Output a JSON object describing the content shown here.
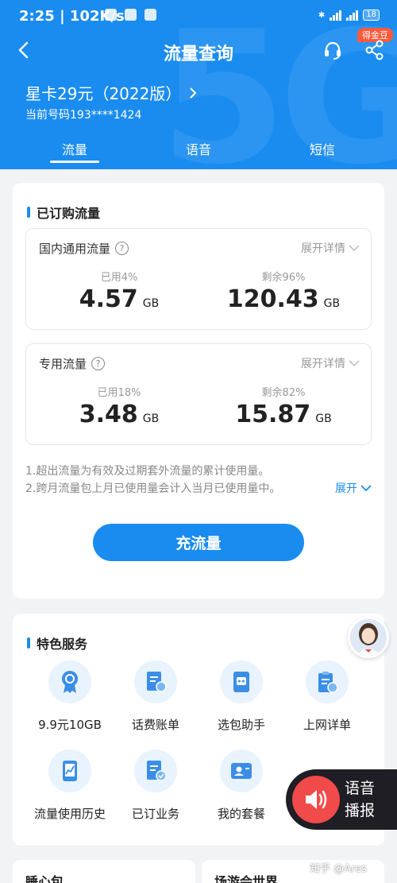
{
  "status_bar": {
    "time": "2:25",
    "speed": "102K/s",
    "battery": "18"
  },
  "header": {
    "title": "流量查询",
    "coupon_badge": "得金豆",
    "plan_name": "星卡29元（2022版）",
    "current_number": "当前号码193****1424"
  },
  "tabs": [
    {
      "label": "流量",
      "active": true
    },
    {
      "label": "语音",
      "active": false
    },
    {
      "label": "短信",
      "active": false
    }
  ],
  "subscribed": {
    "title": "已订购流量",
    "boxes": [
      {
        "title": "国内通用流量",
        "expand": "展开详情",
        "used_label": "已用4%",
        "used_value": "4.57",
        "used_unit": "GB",
        "remain_label": "剩余96%",
        "remain_value": "120.43",
        "remain_unit": "GB"
      },
      {
        "title": "专用流量",
        "expand": "展开详情",
        "used_label": "已用18%",
        "used_value": "3.48",
        "used_unit": "GB",
        "remain_label": "剩余82%",
        "remain_value": "15.87",
        "remain_unit": "GB"
      }
    ],
    "notes": [
      "1.超出流量为有效及过期套外流量的累计使用量。",
      "2.跨月流量包上月已使用量会计入当月已使用量中。"
    ],
    "expand_link": "展开",
    "recharge_button": "充流量"
  },
  "services": {
    "title": "特色服务",
    "items": [
      {
        "label": "9.9元10GB",
        "icon": "badge-icon"
      },
      {
        "label": "话费账单",
        "icon": "bill-icon"
      },
      {
        "label": "选包助手",
        "icon": "robot-icon"
      },
      {
        "label": "上网详单",
        "icon": "clipboard-icon"
      },
      {
        "label": "流量使用历史",
        "icon": "chart-phone-icon"
      },
      {
        "label": "已订业务",
        "icon": "checked-doc-icon"
      },
      {
        "label": "我的套餐",
        "icon": "id-card-icon"
      }
    ]
  },
  "voice_broadcast": {
    "line1": "语音",
    "line2": "播报"
  },
  "bottom_cards": {
    "left": "睡心包",
    "right": "场游会世界"
  },
  "watermark": "知乎 @Ares",
  "colors": {
    "brand_blue": "#1a8cf0",
    "voice_red": "#f04a4a",
    "coupon_red": "#ff5a3c"
  }
}
